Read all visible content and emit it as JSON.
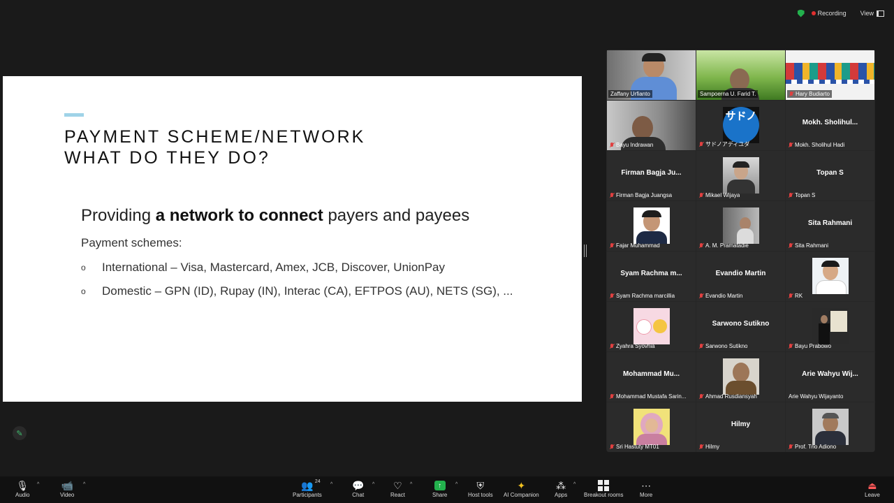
{
  "status": {
    "recording": "Recording",
    "view": "View"
  },
  "slide": {
    "title_line1": "PAYMENT SCHEME/NETWORK",
    "title_line2": "WHAT DO THEY DO?",
    "headline_pre": "Providing ",
    "headline_bold": "a network to connect",
    "headline_post": " payers and payees",
    "subhead": "Payment schemes:",
    "bullet_marker": "o",
    "bullets": [
      "International – Visa, Mastercard, Amex, JCB, Discover, UnionPay",
      "Domestic – GPN (ID), Rupay (IN), Interac (CA), EFTPOS (AU), NETS (SG), ..."
    ]
  },
  "participants": [
    {
      "label": "Zaffany Urfianto",
      "center": ""
    },
    {
      "label": "Sampoerna U. Farid T.",
      "center": ""
    },
    {
      "label": "Hary Budiarto",
      "center": ""
    },
    {
      "label": "Bayu Indrawan",
      "center": ""
    },
    {
      "label": "サドノアディユダ",
      "center": ""
    },
    {
      "label": "Mokh. Sholihul Hadi",
      "center": "Mokh.  Sholihul..."
    },
    {
      "label": "Firman Bagja Juangsa",
      "center": "Firman Bagja Ju..."
    },
    {
      "label": "Mikael Wijaya",
      "center": ""
    },
    {
      "label": "Topan S",
      "center": "Topan S"
    },
    {
      "label": "Fajar Muhammad",
      "center": ""
    },
    {
      "label": "A. M. Pramatadie",
      "center": ""
    },
    {
      "label": "Sita Rahmani",
      "center": "Sita Rahmani"
    },
    {
      "label": "Syam Rachma marcillia",
      "center": "Syam  Rachma m..."
    },
    {
      "label": "Evandio Martin",
      "center": "Evandio Martin"
    },
    {
      "label": "RK",
      "center": ""
    },
    {
      "label": "Zyahra Syovhia",
      "center": ""
    },
    {
      "label": "Sarwono Sutikno",
      "center": "Sarwono Sutikno"
    },
    {
      "label": "Bayu Prabowo",
      "center": ""
    },
    {
      "label": "Mohammad Mustafa Sarin...",
      "center": "Mohammad  Mu..."
    },
    {
      "label": "Ahmad Rusdiansyah",
      "center": ""
    },
    {
      "label": "Arie Wahyu Wijayanto",
      "center": "Arie  Wahyu  Wij..."
    },
    {
      "label": "Sri Hastuty MT01",
      "center": ""
    },
    {
      "label": "Hilmy",
      "center": "Hilmy"
    },
    {
      "label": "Prof. Trio Adiono",
      "center": ""
    }
  ],
  "tile_text": {
    "sadono_logo": "サドノ"
  },
  "toolbar": {
    "audio": "Audio",
    "video": "Video",
    "participants": "Participants",
    "participants_count": "24",
    "chat": "Chat",
    "react": "React",
    "share": "Share",
    "host_tools": "Host tools",
    "ai_companion": "AI Companion",
    "apps": "Apps",
    "breakout_rooms": "Breakout rooms",
    "more": "More",
    "leave": "Leave"
  },
  "colors": {
    "active_speaker": "#23d160",
    "recording": "#e02f2f",
    "share": "#23b14d",
    "slide_accent": "#9fd3e8"
  }
}
